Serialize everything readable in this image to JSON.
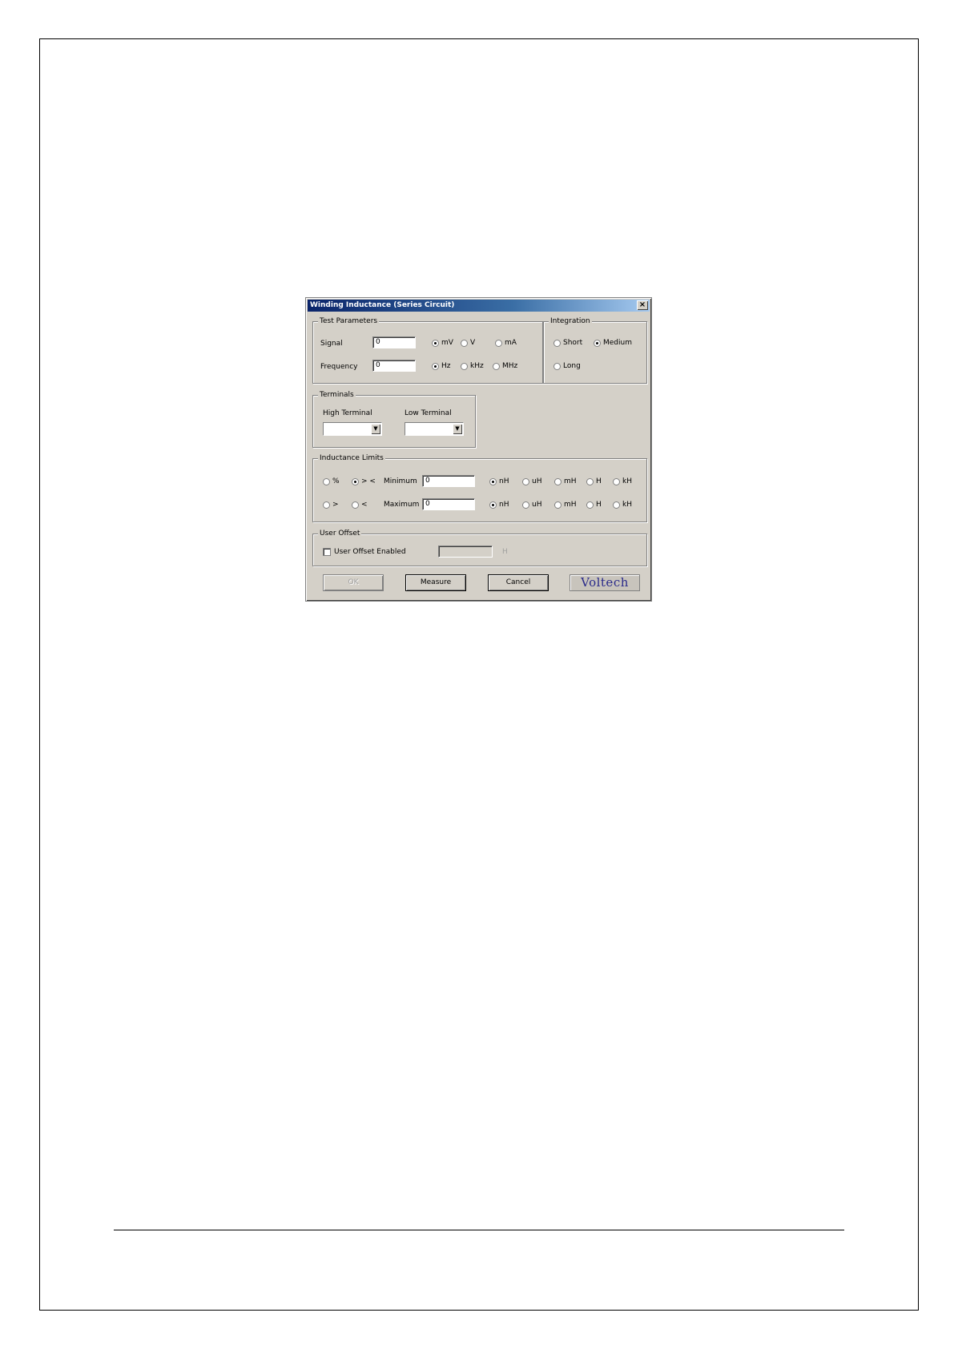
{
  "dialog": {
    "title": "Winding Inductance (Series Circuit)",
    "close_glyph": "×"
  },
  "test_parameters": {
    "title": "Test Parameters",
    "signal_label": "Signal",
    "signal_value": "0",
    "signal_units": [
      "mV",
      "V",
      "mA"
    ],
    "signal_selected": "mV",
    "frequency_label": "Frequency",
    "frequency_value": "0",
    "frequency_units": [
      "Hz",
      "kHz",
      "MHz"
    ],
    "frequency_selected": "Hz"
  },
  "integration": {
    "title": "Integration",
    "options": [
      "Short",
      "Medium",
      "Long"
    ],
    "selected": "Medium"
  },
  "terminals": {
    "title": "Terminals",
    "high_label": "High Terminal",
    "low_label": "Low Terminal",
    "high_value": "",
    "low_value": ""
  },
  "inductance_limits": {
    "title": "Inductance Limits",
    "mode_options": [
      "%",
      "> <",
      ">",
      "<"
    ],
    "mode_selected": "> <",
    "minimum_label": "Minimum",
    "minimum_value": "0",
    "maximum_label": "Maximum",
    "maximum_value": "0",
    "units": [
      "nH",
      "uH",
      "mH",
      "H",
      "kH"
    ],
    "minimum_unit_selected": "nH",
    "maximum_unit_selected": "nH"
  },
  "user_offset": {
    "title": "User Offset",
    "checkbox_label": "User Offset Enabled",
    "checked": false,
    "value": "",
    "unit": "H"
  },
  "buttons": {
    "ok": "OK",
    "measure": "Measure",
    "cancel": "Cancel"
  },
  "logo_text": "Voltech"
}
